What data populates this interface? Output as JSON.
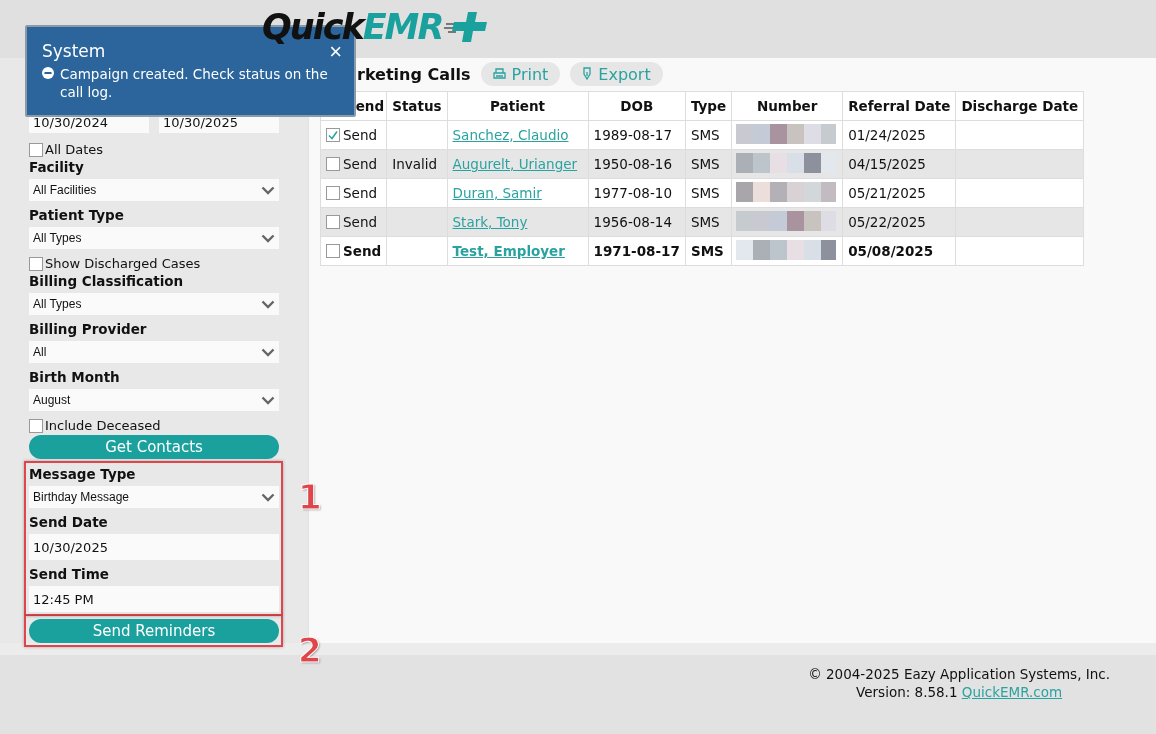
{
  "header": {
    "logo": {
      "part_1": "Quick",
      "part_2": "EMR"
    }
  },
  "notification": {
    "title": "System",
    "message": "Campaign created. Check status on the call log.",
    "close": "×"
  },
  "sidebar": {
    "sections": [
      {
        "items": [
          {
            "kind": "daterange",
            "from": "10/30/2024",
            "to": "10/30/2025"
          },
          {
            "kind": "checkbox",
            "label": "All Dates",
            "checked": false
          },
          {
            "kind": "select",
            "label": "Facility",
            "value": "All Facilities"
          },
          {
            "kind": "select",
            "label": "Patient Type",
            "value": "All Types"
          },
          {
            "kind": "checkbox",
            "label": "Show Discharged Cases",
            "checked": false
          },
          {
            "kind": "select",
            "label": "Billing Classification",
            "value": "All Types"
          },
          {
            "kind": "select",
            "label": "Billing Provider",
            "value": "All"
          },
          {
            "kind": "select",
            "label": "Birth Month",
            "value": "August"
          },
          {
            "kind": "checkbox",
            "label": "Include Deceased",
            "checked": false
          },
          {
            "kind": "button",
            "label": "Get Contacts"
          }
        ]
      },
      {
        "callout": "1",
        "items": [
          {
            "kind": "select",
            "label": "Message Type",
            "value": "Birthday Message"
          },
          {
            "kind": "text",
            "label": "Send Date",
            "value": "10/30/2025"
          },
          {
            "kind": "text",
            "label": "Send Time",
            "value": "12:45 PM"
          }
        ]
      },
      {
        "callout": "2",
        "items": [
          {
            "kind": "button",
            "label": "Send Reminders"
          }
        ]
      }
    ]
  },
  "marketing_calls": {
    "title": "rketing Calls",
    "actions": [
      {
        "kind": "print",
        "label": "Print"
      },
      {
        "kind": "export",
        "label": "Export"
      }
    ],
    "columns": [
      "end",
      "Status",
      "Patient",
      "DOB",
      "Type",
      "Number",
      "Referral Date",
      "Discharge Date"
    ],
    "rows": [
      {
        "checked": true,
        "bold": false,
        "send": "Send",
        "patient": "Sanchez, Claudio",
        "dob": "1989-08-17",
        "type": "SMS",
        "referral_date": "01/24/2025"
      },
      {
        "checked": false,
        "bold": false,
        "send": "Send",
        "status": "Invalid",
        "patient": "Augurelt, Urianger",
        "dob": "1950-08-16",
        "type": "SMS",
        "referral_date": "04/15/2025"
      },
      {
        "checked": false,
        "bold": false,
        "send": "Send",
        "patient": "Duran, Samir",
        "dob": "1977-08-10",
        "type": "SMS",
        "referral_date": "05/21/2025"
      },
      {
        "checked": false,
        "bold": false,
        "send": "Send",
        "patient": "Stark, Tony",
        "dob": "1956-08-14",
        "type": "SMS",
        "referral_date": "05/22/2025"
      },
      {
        "checked": false,
        "bold": true,
        "send": "Send",
        "patient": "Test, Employer",
        "dob": "1971-08-17",
        "type": "SMS",
        "referral_date": "05/08/2025"
      }
    ]
  },
  "footer": {
    "copyright": "© 2004-2025 Eazy Application Systems, Inc.",
    "version": "Version: 8.58.1",
    "link": "QuickEMR.com"
  }
}
